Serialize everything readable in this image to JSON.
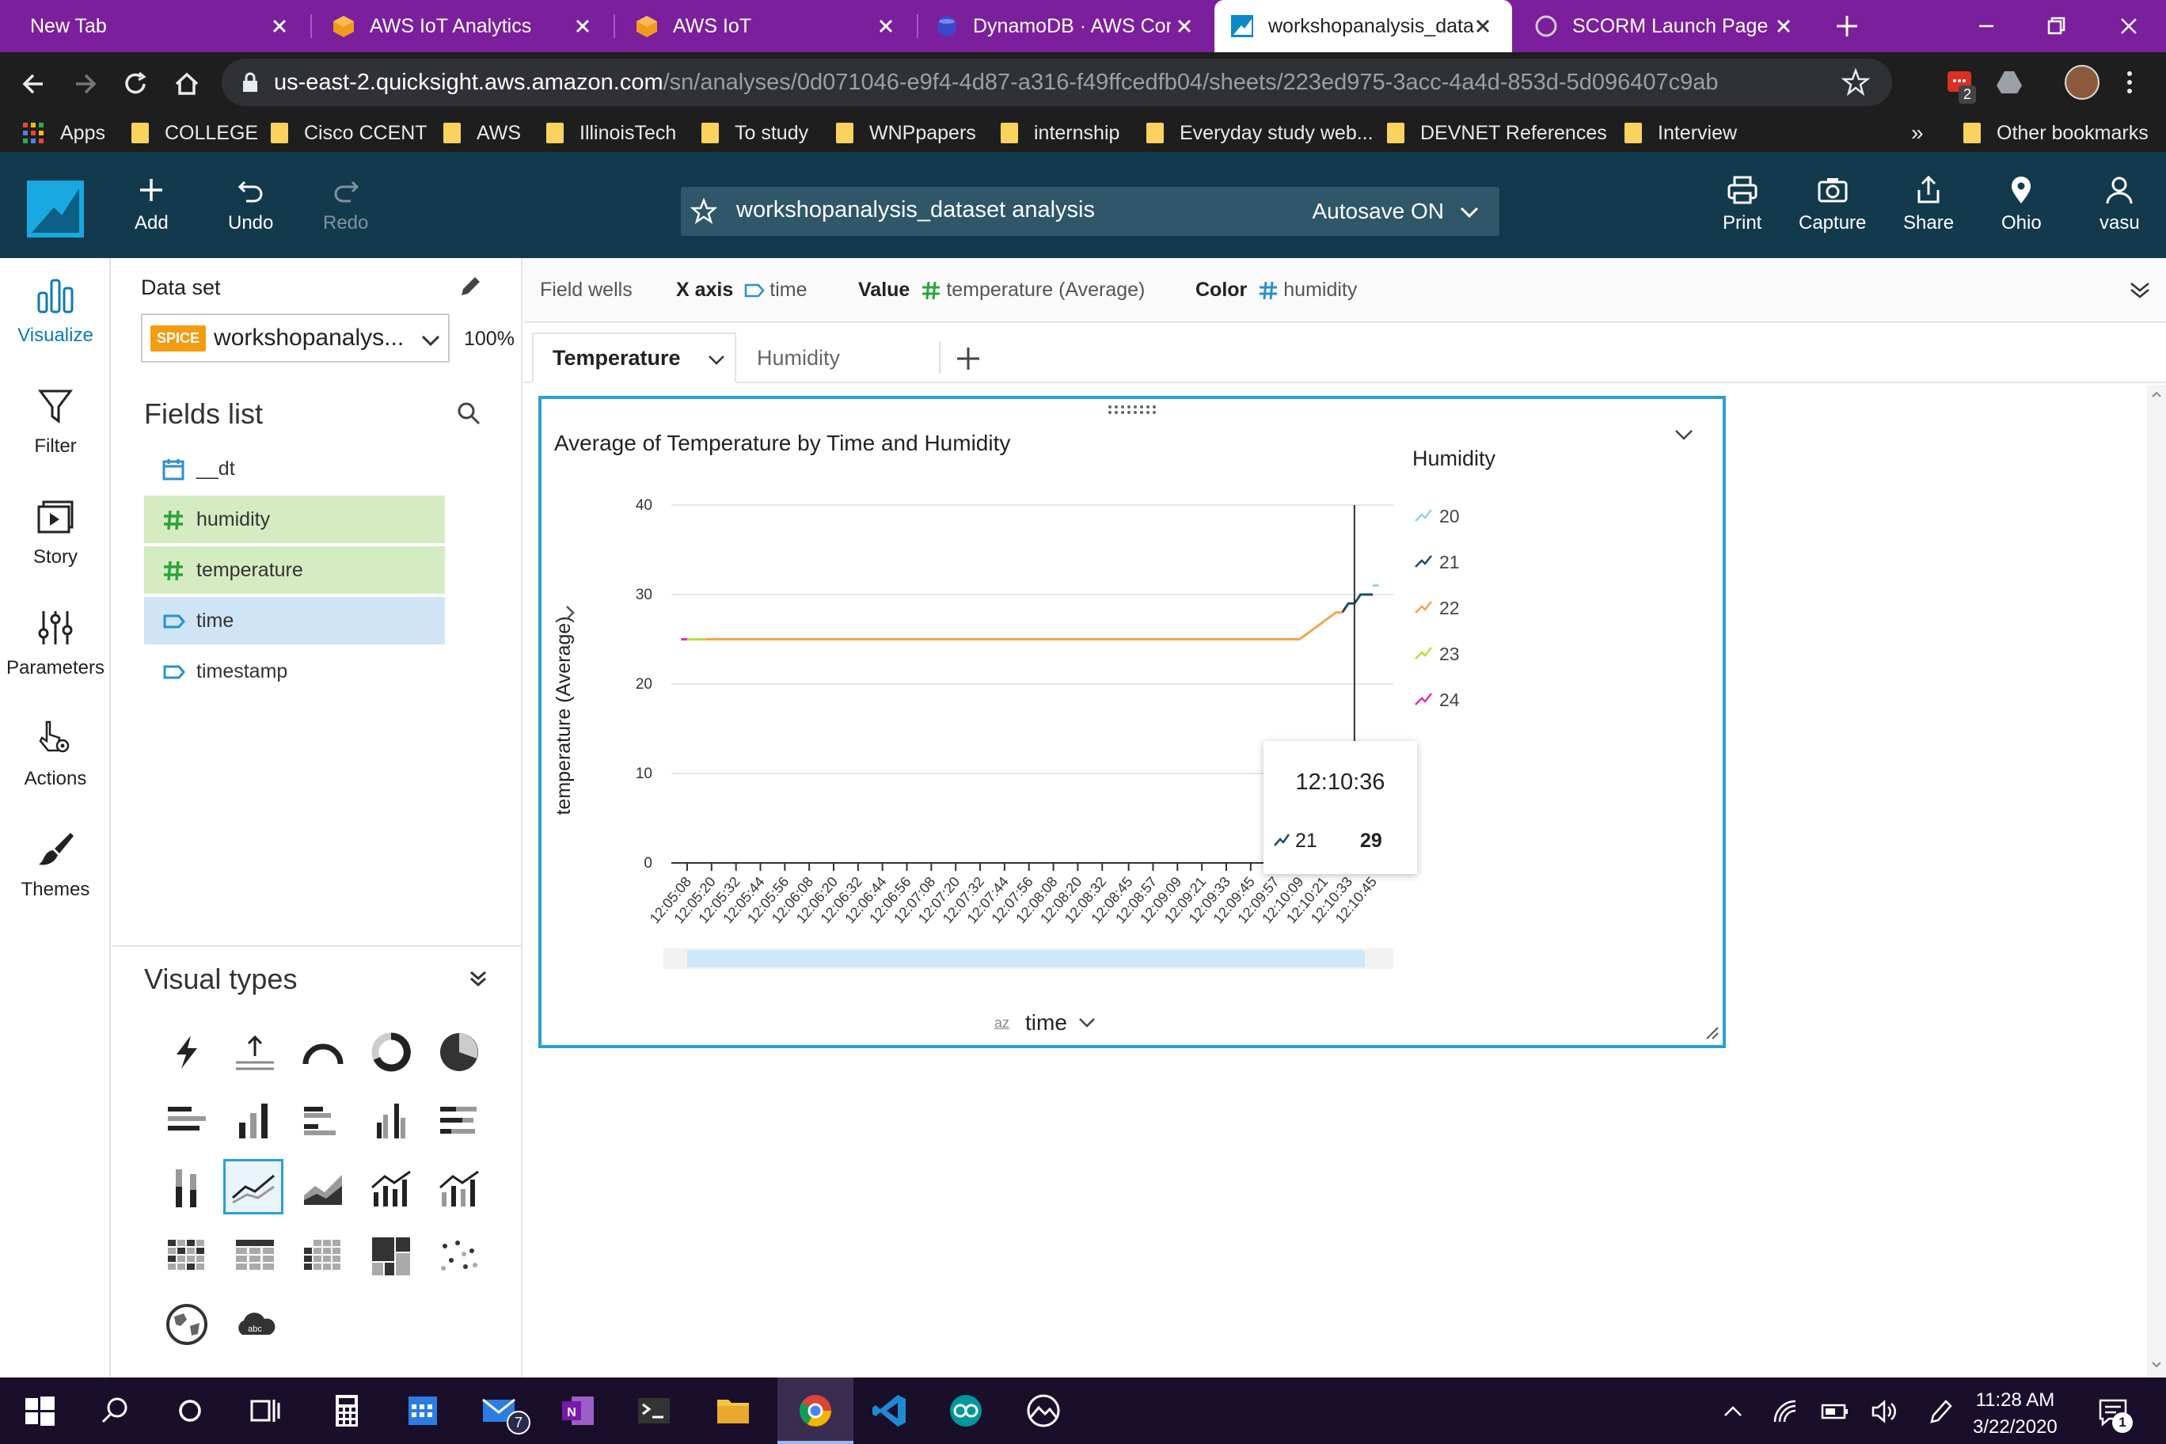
{
  "browser": {
    "tabs": [
      {
        "title": "New Tab"
      },
      {
        "title": "AWS IoT Analytics"
      },
      {
        "title": "AWS IoT"
      },
      {
        "title": "DynamoDB · AWS Cons"
      },
      {
        "title": "workshopanalysis_data"
      },
      {
        "title": "SCORM Launch Page"
      }
    ],
    "url_host": "us-east-2.quicksight.aws.amazon.com",
    "url_path": "/sn/analyses/0d071046-e9f4-4d87-a316-f49ffcedfb04/sheets/223ed975-3acc-4a4d-853d-5d096407c9ab",
    "extension_badge": "2",
    "bookmarks": [
      "Apps",
      "COLLEGE",
      "Cisco CCENT",
      "AWS",
      "IllinoisTech",
      "To study",
      "WNPpapers",
      "internship",
      "Everyday study web...",
      "DEVNET References",
      "Interview"
    ],
    "bookmarks_more": "»",
    "other_bookmarks": "Other bookmarks"
  },
  "header": {
    "add": "Add",
    "undo": "Undo",
    "redo": "Redo",
    "analysis_title": "workshopanalysis_dataset analysis",
    "autosave": "Autosave ON",
    "print": "Print",
    "capture": "Capture",
    "share": "Share",
    "region": "Ohio",
    "user": "vasu"
  },
  "rail": {
    "visualize": "Visualize",
    "filter": "Filter",
    "story": "Story",
    "parameters": "Parameters",
    "actions": "Actions",
    "themes": "Themes"
  },
  "panel": {
    "dataset_label": "Data set",
    "spice": "SPICE",
    "dataset_name": "workshopanalys...",
    "percent": "100%",
    "fields_title": "Fields list",
    "fields": [
      "__dt",
      "humidity",
      "temperature",
      "time",
      "timestamp"
    ],
    "visual_types_title": "Visual types"
  },
  "wells": {
    "title": "Field wells",
    "x_label": "X axis",
    "x_value": "time",
    "value_label": "Value",
    "value_value": "temperature (Average)",
    "color_label": "Color",
    "color_value": "humidity"
  },
  "sheets": {
    "active": "Temperature",
    "inactive": "Humidity",
    "add": "+"
  },
  "visual": {
    "title": "Average of Temperature by Time and Humidity",
    "legend_title": "Humidity",
    "tooltip_time": "12:10:36",
    "tooltip_key": "21",
    "tooltip_value": "29",
    "x_field": "time",
    "x_field_sort_icon": "az"
  },
  "chart_data": {
    "type": "line",
    "title": "Average of Temperature by Time and Humidity",
    "ylabel": "temperature (Average)",
    "xlabel": "time",
    "ylim": [
      0,
      40
    ],
    "yticks": [
      0,
      10,
      20,
      30,
      40
    ],
    "grid": true,
    "legend_title": "Humidity",
    "legend_position": "right",
    "x_tick_labels": [
      "12:05:08",
      "12:05:20",
      "12:05:32",
      "12:05:44",
      "12:05:56",
      "12:06:08",
      "12:06:20",
      "12:06:32",
      "12:06:44",
      "12:06:56",
      "12:07:08",
      "12:07:20",
      "12:07:32",
      "12:07:44",
      "12:07:56",
      "12:08:08",
      "12:08:20",
      "12:08:32",
      "12:08:45",
      "12:08:57",
      "12:09:09",
      "12:09:21",
      "12:09:33",
      "12:09:45",
      "12:09:57",
      "12:10:09",
      "12:10:21",
      "12:10:33",
      "12:10:45"
    ],
    "series": [
      {
        "name": "20",
        "color": "#8fd3ea",
        "points": [
          [
            "12:10:45",
            31
          ],
          [
            "12:10:48",
            31
          ]
        ]
      },
      {
        "name": "21",
        "color": "#1f4e66",
        "points": [
          [
            "12:10:30",
            28
          ],
          [
            "12:10:33",
            29
          ],
          [
            "12:10:36",
            29
          ],
          [
            "12:10:39",
            30
          ],
          [
            "12:10:42",
            30
          ],
          [
            "12:10:45",
            30
          ]
        ]
      },
      {
        "name": "22",
        "color": "#f5a24a",
        "points": [
          [
            "12:05:17",
            25
          ],
          [
            "12:06:00",
            25
          ],
          [
            "12:07:00",
            25
          ],
          [
            "12:08:00",
            25
          ],
          [
            "12:09:00",
            25
          ],
          [
            "12:10:00",
            25
          ],
          [
            "12:10:09",
            25
          ],
          [
            "12:10:15",
            26
          ],
          [
            "12:10:21",
            27
          ],
          [
            "12:10:27",
            28
          ],
          [
            "12:10:30",
            28
          ]
        ]
      },
      {
        "name": "23",
        "color": "#b6e03a",
        "points": [
          [
            "12:05:08",
            25
          ],
          [
            "12:05:17",
            25
          ]
        ]
      },
      {
        "name": "24",
        "color": "#e52bbf",
        "points": [
          [
            "12:05:05",
            25
          ],
          [
            "12:05:08",
            25
          ]
        ]
      }
    ],
    "cursor_time": "12:10:36"
  },
  "taskbar": {
    "time": "11:28 AM",
    "date": "3/22/2020",
    "mail_badge": "7",
    "notif_badge": "1"
  }
}
